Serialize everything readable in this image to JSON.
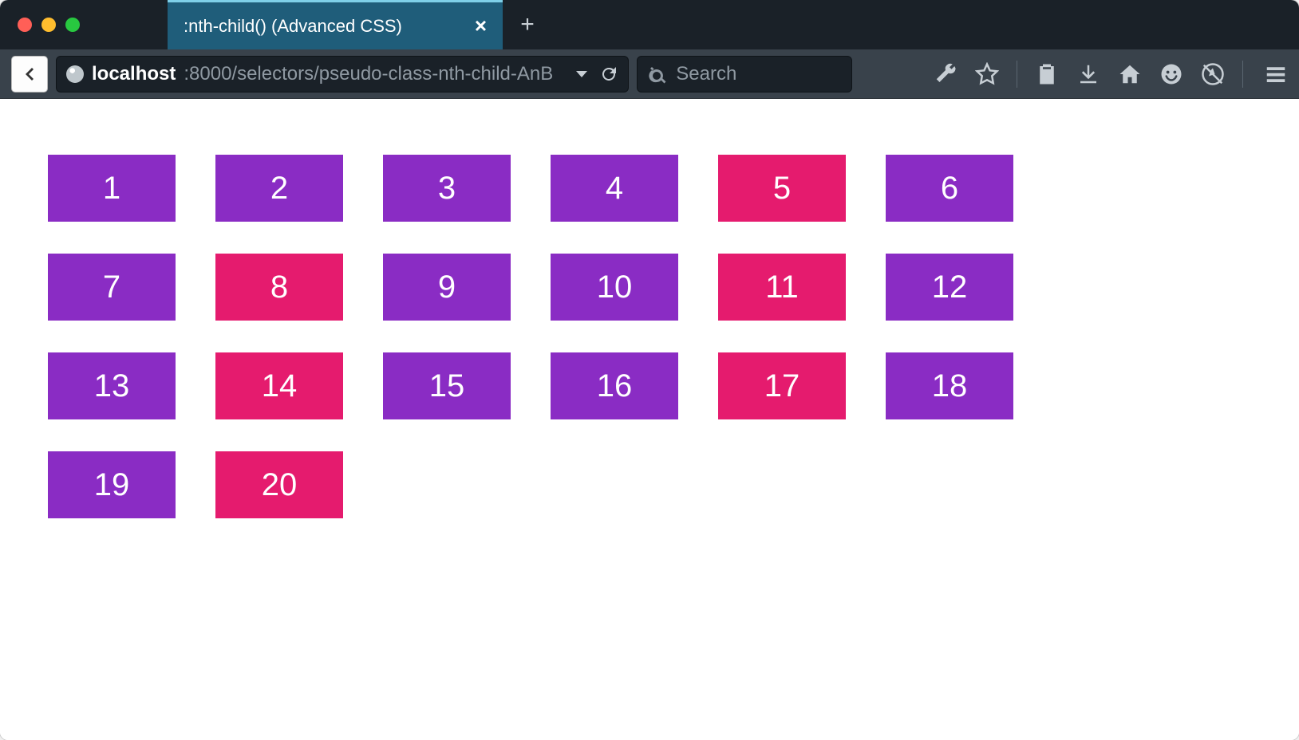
{
  "colors": {
    "purple": "#8a2cc4",
    "pink": "#e51b6e"
  },
  "window": {
    "tab_title": ":nth-child() (Advanced CSS)"
  },
  "address": {
    "host": "localhost",
    "path": ":8000/selectors/pseudo-class-nth-child-AnB"
  },
  "search": {
    "placeholder": "Search"
  },
  "grid": {
    "columns": 7,
    "cells": [
      {
        "n": "1",
        "color": "purple"
      },
      {
        "n": "2",
        "color": "purple"
      },
      {
        "n": "3",
        "color": "purple"
      },
      {
        "n": "4",
        "color": "purple"
      },
      {
        "n": "5",
        "color": "pink"
      },
      {
        "n": "6",
        "color": "purple"
      },
      {
        "n": "7",
        "color": "purple"
      },
      {
        "n": "8",
        "color": "pink"
      },
      {
        "n": "9",
        "color": "purple"
      },
      {
        "n": "10",
        "color": "purple"
      },
      {
        "n": "11",
        "color": "pink"
      },
      {
        "n": "12",
        "color": "purple"
      },
      {
        "n": "13",
        "color": "purple"
      },
      {
        "n": "14",
        "color": "pink"
      },
      {
        "n": "15",
        "color": "purple"
      },
      {
        "n": "16",
        "color": "purple"
      },
      {
        "n": "17",
        "color": "pink"
      },
      {
        "n": "18",
        "color": "purple"
      },
      {
        "n": "19",
        "color": "purple"
      },
      {
        "n": "20",
        "color": "pink"
      }
    ]
  }
}
